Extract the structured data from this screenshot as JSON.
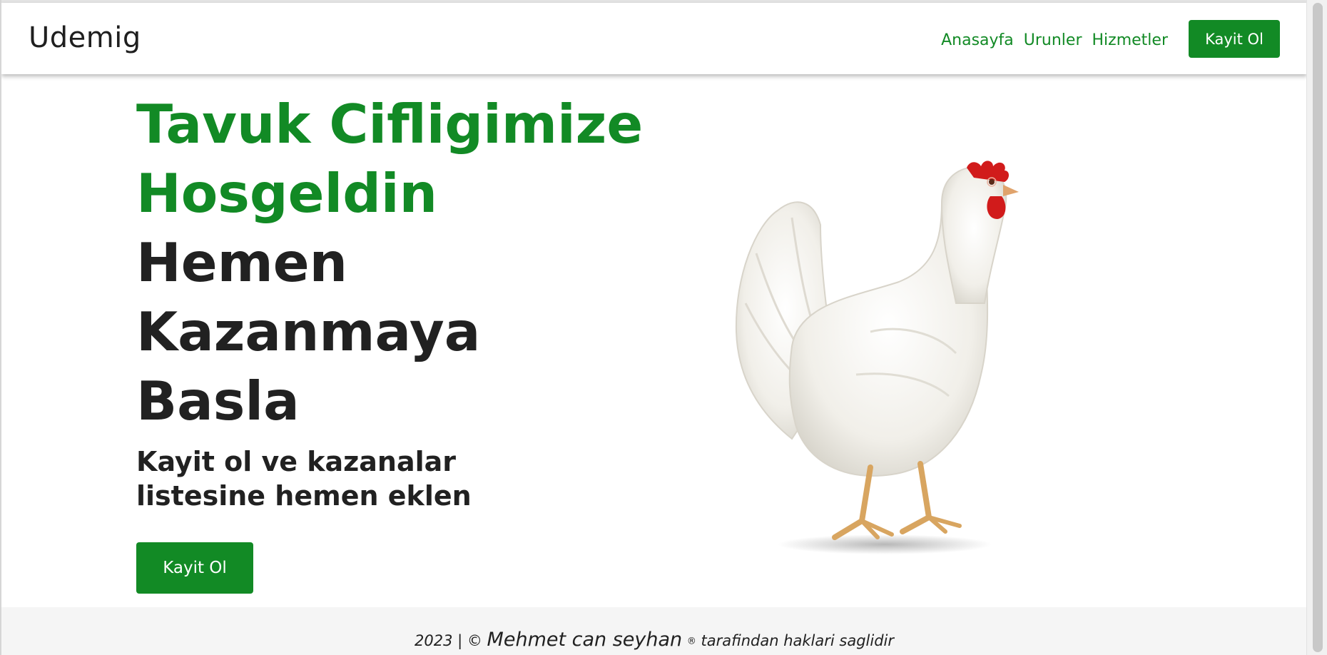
{
  "navbar": {
    "brand": "Udemig",
    "links": [
      "Anasayfa",
      "Urunler",
      "Hizmetler"
    ],
    "cta": "Kayit Ol"
  },
  "hero": {
    "title_green_1": "Tavuk Cifligimize",
    "title_green_2": "Hosgeldin",
    "title_dark_1": "Hemen",
    "title_dark_2": "Kazanmaya",
    "title_dark_3": "Basla",
    "subtitle": "Kayit ol ve kazanalar listesine hemen eklen",
    "cta": "Kayit Ol"
  },
  "footer": {
    "prefix": "2023 | ©",
    "name": "Mehmet can seyhan",
    "reg": "®",
    "suffix": "tarafindan haklari saglidir"
  },
  "colors": {
    "accent": "#128a25",
    "text": "#212121",
    "footer_bg": "#f5f5f5"
  },
  "icons": {
    "hero_image": "white-chicken-illustration"
  }
}
